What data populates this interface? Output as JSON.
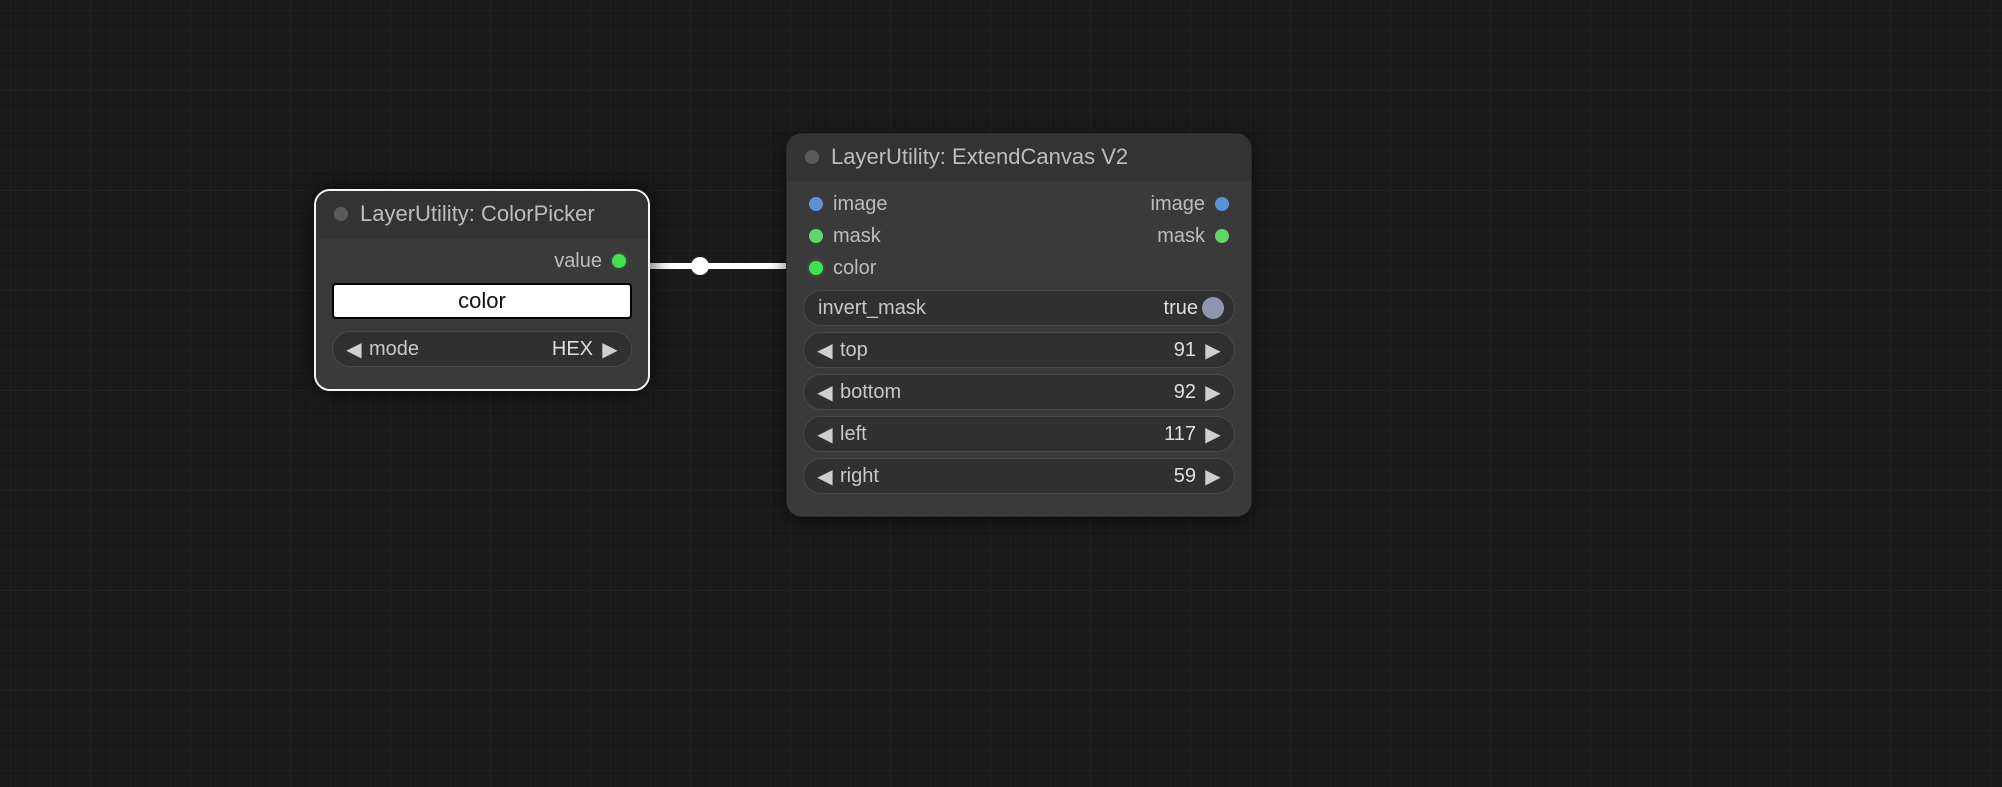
{
  "nodes": {
    "colorPicker": {
      "title": "LayerUtility: ColorPicker",
      "outputs": {
        "value": {
          "label": "value"
        }
      },
      "colorSwatchLabel": "color",
      "colorSwatchValue": "#FFFFFF",
      "modeWidget": {
        "label": "mode",
        "value": "HEX"
      }
    },
    "extendCanvas": {
      "title": "LayerUtility: ExtendCanvas V2",
      "inputs": {
        "image": {
          "label": "image"
        },
        "mask": {
          "label": "mask"
        },
        "color": {
          "label": "color"
        }
      },
      "outputs": {
        "image": {
          "label": "image"
        },
        "mask": {
          "label": "mask"
        }
      },
      "widgets": {
        "invert_mask": {
          "label": "invert_mask",
          "value": "true"
        },
        "top": {
          "label": "top",
          "value": "91"
        },
        "bottom": {
          "label": "bottom",
          "value": "92"
        },
        "left": {
          "label": "left",
          "value": "117"
        },
        "right": {
          "label": "right",
          "value": "59"
        }
      }
    }
  },
  "port_colors": {
    "image": "#5b8fd6",
    "mask": "#5fd66a",
    "color": "#3fe24f",
    "value": "#3fe24f"
  }
}
